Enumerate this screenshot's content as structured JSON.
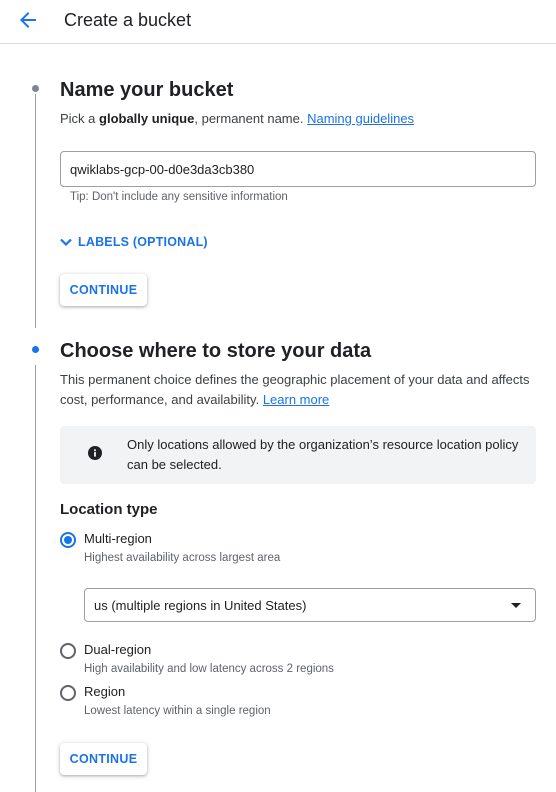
{
  "header": {
    "title": "Create a bucket",
    "back_icon": "arrow-back-icon"
  },
  "colors": {
    "accent": "#1a73e8",
    "text": "#202124",
    "muted": "#5f6368",
    "info_bg": "#f1f3f4",
    "step_done": "#80868b",
    "step_active": "#1a73e8"
  },
  "step1": {
    "title": "Name your bucket",
    "desc_prefix": "Pick a ",
    "desc_bold": "globally unique",
    "desc_suffix": ", permanent name. ",
    "guidelines_link": "Naming guidelines",
    "bucket_name_value": "qwiklabs-gcp-00-d0e3da3cb380",
    "tip": "Tip: Don't include any sensitive information",
    "labels_toggle": "LABELS (OPTIONAL)",
    "continue_label": "CONTINUE"
  },
  "step2": {
    "title": "Choose where to store your data",
    "desc": "This permanent choice defines the geographic placement of your data and affects cost, performance, and availability. ",
    "learn_more": "Learn more",
    "info_text": "Only locations allowed by the organization’s resource location policy can be selected.",
    "info_icon": "info-icon",
    "location_type_heading": "Location type",
    "options": [
      {
        "label": "Multi-region",
        "sub": "Highest availability across largest area",
        "selected": true
      },
      {
        "label": "Dual-region",
        "sub": "High availability and low latency across 2 regions",
        "selected": false
      },
      {
        "label": "Region",
        "sub": "Lowest latency within a single region",
        "selected": false
      }
    ],
    "multi_region_select_value": "us (multiple regions in United States)",
    "continue_label": "CONTINUE"
  }
}
